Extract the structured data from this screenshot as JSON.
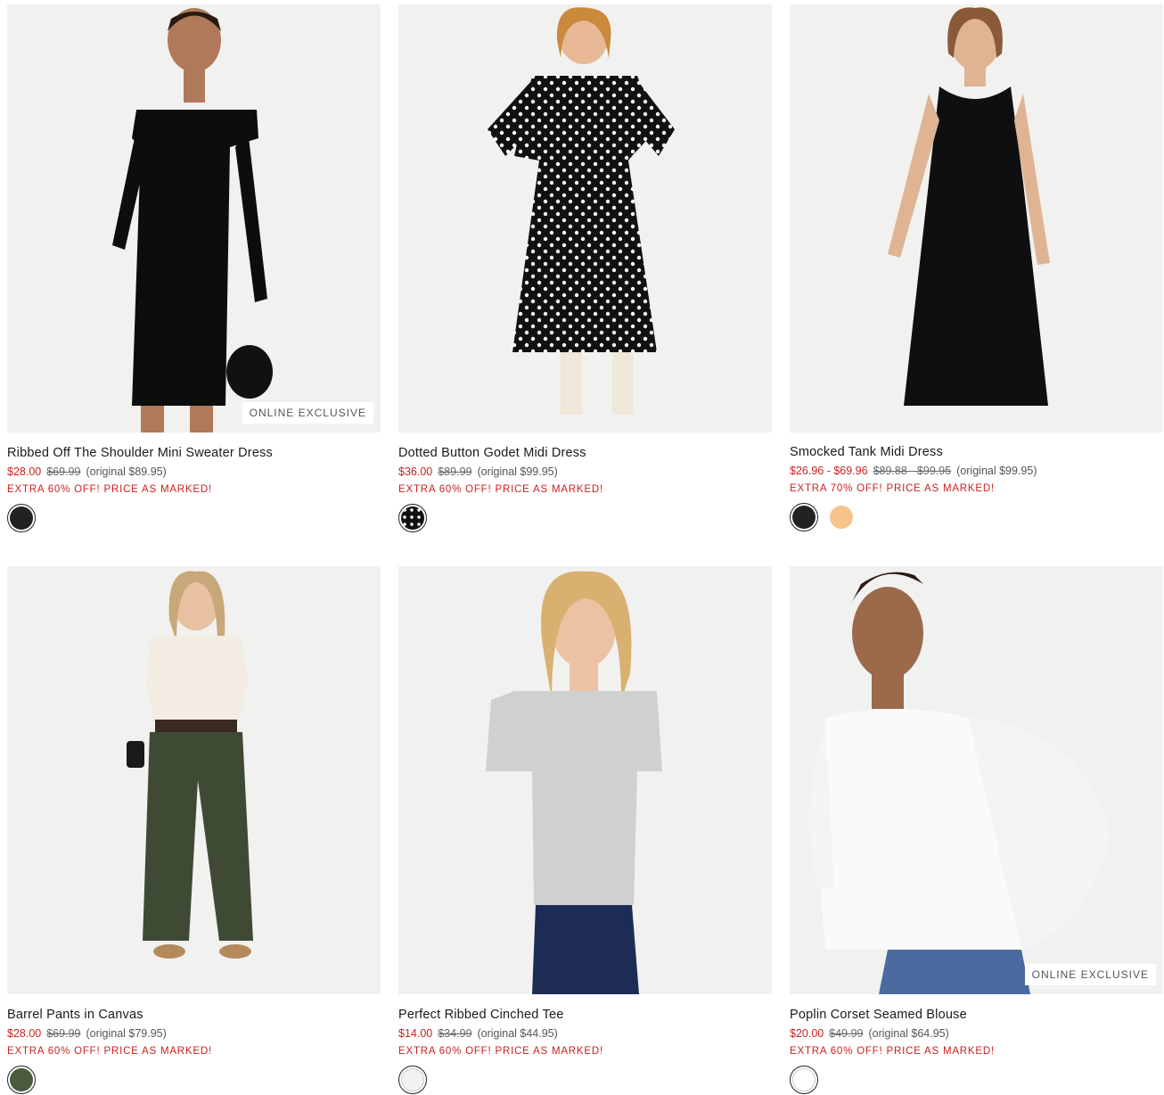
{
  "products": [
    {
      "name": "Ribbed Off The Shoulder Mini Sweater Dress",
      "sale_price": "$28.00",
      "was_price": "$69.99",
      "original": "(original $89.95)",
      "promo": "EXTRA 60% OFF! PRICE AS MARKED!",
      "badge": "ONLINE EXCLUSIVE",
      "swatches": [
        {
          "color": "#222222",
          "selected": true
        }
      ]
    },
    {
      "name": "Dotted Button Godet Midi Dress",
      "sale_price": "$36.00",
      "was_price": "$89.99",
      "original": "(original $99.95)",
      "promo": "EXTRA 60% OFF! PRICE AS MARKED!",
      "badge": "",
      "swatches": [
        {
          "color": "#111111",
          "pattern": "dots",
          "selected": true
        }
      ]
    },
    {
      "name": "Smocked Tank Midi Dress",
      "sale_price": "$26.96 - $69.96",
      "was_price": "$89.88 - $99.95",
      "original": "(original $99.95)",
      "promo": "EXTRA 70% OFF! PRICE AS MARKED!",
      "badge": "",
      "swatches": [
        {
          "color": "#222222",
          "selected": true
        },
        {
          "color": "#f6c48a",
          "selected": false
        }
      ]
    },
    {
      "name": "Barrel Pants in Canvas",
      "sale_price": "$28.00",
      "was_price": "$69.99",
      "original": "(original $79.95)",
      "promo": "EXTRA 60% OFF! PRICE AS MARKED!",
      "badge": "",
      "swatches": [
        {
          "color": "#4a5a3c",
          "selected": true
        }
      ]
    },
    {
      "name": "Perfect Ribbed Cinched Tee",
      "sale_price": "$14.00",
      "was_price": "$34.99",
      "original": "(original $44.95)",
      "promo": "EXTRA 60% OFF! PRICE AS MARKED!",
      "badge": "",
      "swatches": [
        {
          "color": "#f2f2f2",
          "selected": true
        }
      ]
    },
    {
      "name": "Poplin Corset Seamed Blouse",
      "sale_price": "$20.00",
      "was_price": "$49.99",
      "original": "(original $64.95)",
      "promo": "EXTRA 60% OFF! PRICE AS MARKED!",
      "badge": "ONLINE EXCLUSIVE",
      "swatches": [
        {
          "color": "#ffffff",
          "selected": true
        }
      ]
    }
  ],
  "colors": {
    "sale": "#cc1f1f",
    "image_bg": "#f1f1f0"
  }
}
